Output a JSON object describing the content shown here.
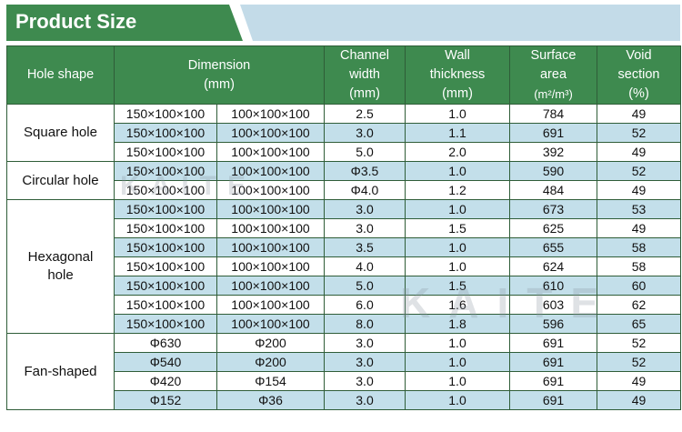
{
  "header": {
    "title": "Product Size"
  },
  "table": {
    "headers": {
      "hole_shape": "Hole shape",
      "dimension": "Dimension\n(mm)",
      "channel_width": "Channel\nwidth\n(mm)",
      "wall_thickness": "Wall\nthickness\n(mm)",
      "surface_area_line1": "Surface\narea",
      "surface_area_unit": "(m²/m³)",
      "void_section": "Void\nsection\n(%)"
    },
    "groups": [
      {
        "shape": "Square hole",
        "rows": [
          [
            "150×100×100",
            "100×100×100",
            "2.5",
            "1.0",
            "784",
            "49"
          ],
          [
            "150×100×100",
            "100×100×100",
            "3.0",
            "1.1",
            "691",
            "52"
          ],
          [
            "150×100×100",
            "100×100×100",
            "5.0",
            "2.0",
            "392",
            "49"
          ]
        ]
      },
      {
        "shape": "Circular hole",
        "rows": [
          [
            "150×100×100",
            "100×100×100",
            "Φ3.5",
            "1.0",
            "590",
            "52"
          ],
          [
            "150×100×100",
            "100×100×100",
            "Φ4.0",
            "1.2",
            "484",
            "49"
          ]
        ]
      },
      {
        "shape": "Hexagonal\nhole",
        "rows": [
          [
            "150×100×100",
            "100×100×100",
            "3.0",
            "1.0",
            "673",
            "53"
          ],
          [
            "150×100×100",
            "100×100×100",
            "3.0",
            "1.5",
            "625",
            "49"
          ],
          [
            "150×100×100",
            "100×100×100",
            "3.5",
            "1.0",
            "655",
            "58"
          ],
          [
            "150×100×100",
            "100×100×100",
            "4.0",
            "1.0",
            "624",
            "58"
          ],
          [
            "150×100×100",
            "100×100×100",
            "5.0",
            "1.5",
            "610",
            "60"
          ],
          [
            "150×100×100",
            "100×100×100",
            "6.0",
            "1.6",
            "603",
            "62"
          ],
          [
            "150×100×100",
            "100×100×100",
            "8.0",
            "1.8",
            "596",
            "65"
          ]
        ]
      },
      {
        "shape": "Fan-shaped",
        "rows": [
          [
            "Φ630",
            "Φ200",
            "3.0",
            "1.0",
            "691",
            "52"
          ],
          [
            "Φ540",
            "Φ200",
            "3.0",
            "1.0",
            "691",
            "52"
          ],
          [
            "Φ420",
            "Φ154",
            "3.0",
            "1.0",
            "691",
            "49"
          ],
          [
            "Φ152",
            "Φ36",
            "3.0",
            "1.0",
            "691",
            "49"
          ]
        ]
      }
    ]
  },
  "watermark": {
    "text": "KAITE"
  },
  "colors": {
    "header_green": "#3e8a4f",
    "row_blue": "#c3dfea",
    "banner_blue": "#c3dbe8"
  }
}
